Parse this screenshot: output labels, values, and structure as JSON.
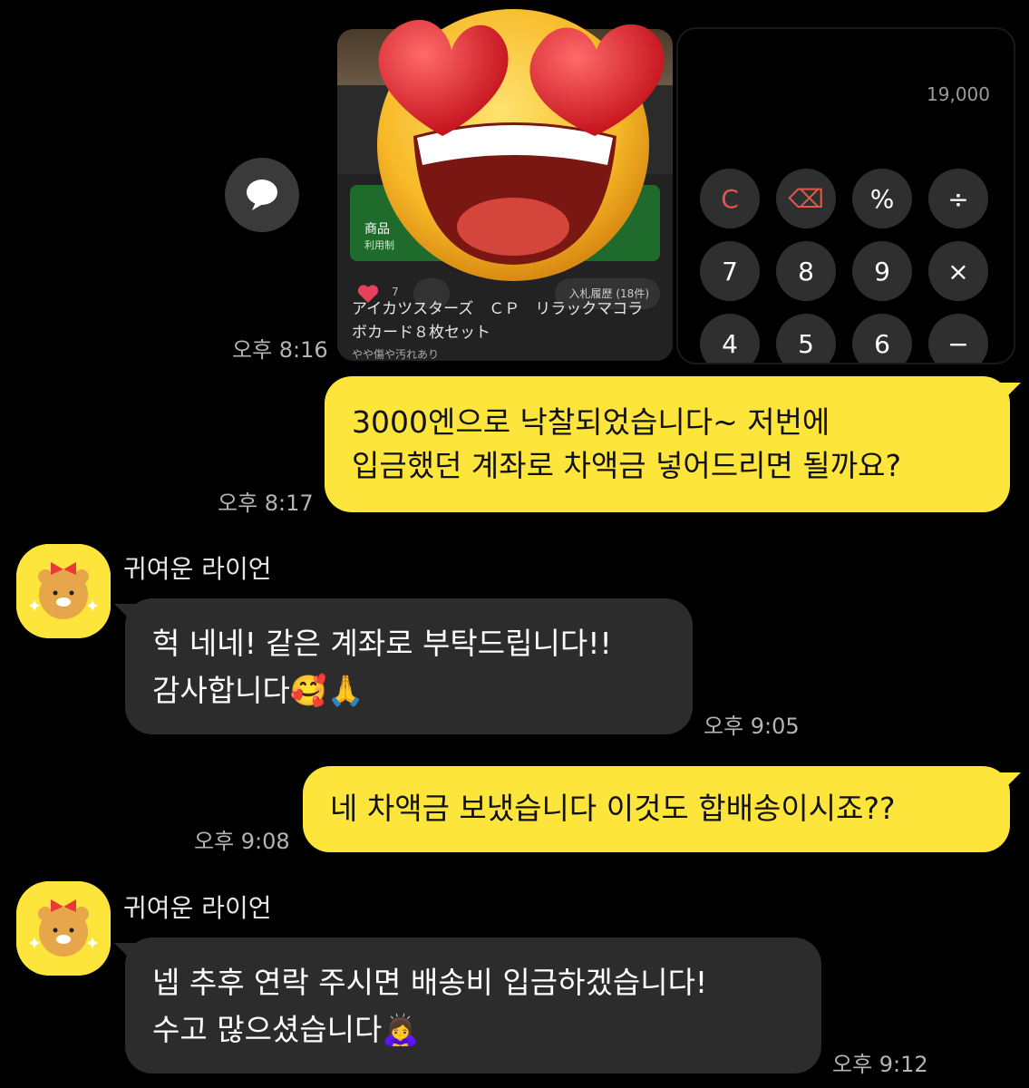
{
  "shared_image": {
    "calculator": {
      "display": "19,000",
      "keys": [
        "C",
        "⌫",
        "%",
        "÷",
        "7",
        "8",
        "9",
        "×",
        "4",
        "5",
        "6",
        "−"
      ]
    },
    "listing": {
      "banner_title": "商品",
      "banner_sub": "利用制",
      "like_count": "7",
      "bid_history": "入札履歴 (18件)",
      "title_line1": "アイカツスターズ　ＣＰ　リラックマコラ",
      "title_line2": "ボカード８枚セット",
      "condition": "やや傷や汚れあり"
    },
    "sticker": "heart-eyes-emoji"
  },
  "messages": [
    {
      "side": "me",
      "time": "오후 8:16"
    },
    {
      "side": "me",
      "time": "오후 8:17",
      "lines": [
        "3000엔으로 낙찰되었습니다~ 저번에",
        "입금했던 계좌로 차액금 넣어드리면 될까요?"
      ]
    },
    {
      "side": "them",
      "name": "귀여운 라이언",
      "time": "오후 9:05",
      "lines": [
        "헉 네네! 같은 계좌로 부탁드립니다!!",
        "감사합니다🥰🙏"
      ]
    },
    {
      "side": "me",
      "time": "오후 9:08",
      "lines": [
        "네 차액금 보냈습니다 이것도 합배송이시죠??"
      ]
    },
    {
      "side": "them",
      "name": "귀여운 라이언",
      "time": "오후 9:12",
      "lines": [
        "넵 추후 연락 주시면 배송비 입금하겠습니다!",
        "수고 많으셨습니다🙇‍♀️"
      ]
    }
  ],
  "colors": {
    "background": "#000000",
    "my_bubble": "#fde53b",
    "their_bubble": "#2c2c2c",
    "timestamp": "#b4b4b4"
  }
}
